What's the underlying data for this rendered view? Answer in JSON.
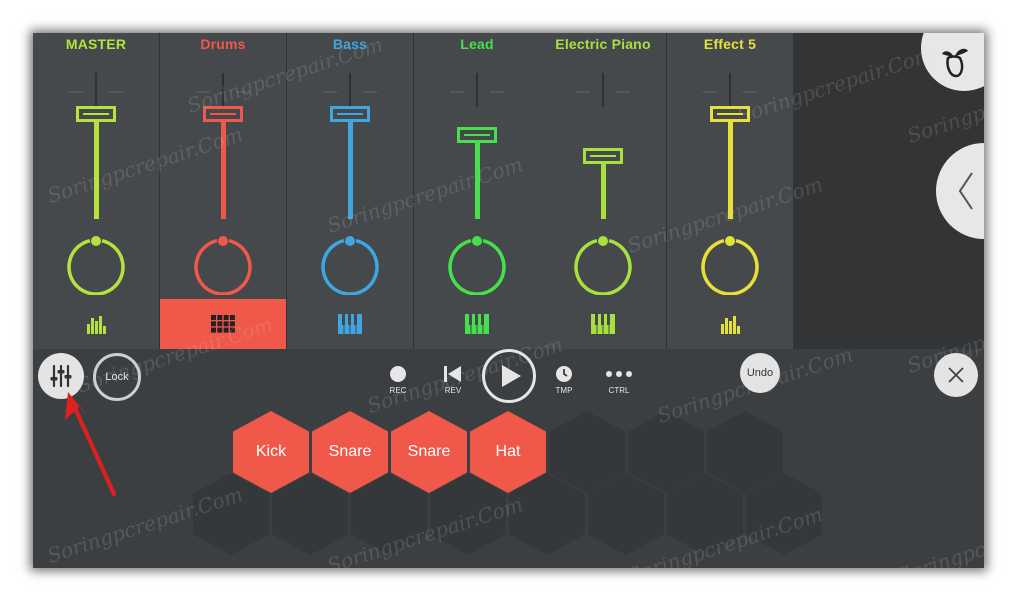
{
  "mixer": {
    "channels": [
      {
        "name": "MASTER",
        "color": "#b6e33b",
        "level": 0.7,
        "icon": "equalizer-bars-icon"
      },
      {
        "name": "Drums",
        "color": "#f0584a",
        "level": 0.7,
        "icon": "drum-pads-icon",
        "selected": true
      },
      {
        "name": "Bass",
        "color": "#3fa6e2",
        "level": 0.7,
        "icon": "piano-keys-icon"
      },
      {
        "name": "Lead",
        "color": "#45e04b",
        "level": 0.55,
        "icon": "piano-keys-icon"
      },
      {
        "name": "Electric Piano",
        "color": "#a8e03d",
        "level": 0.4,
        "icon": "piano-keys-icon"
      },
      {
        "name": "Effect 5",
        "color": "#e6e038",
        "level": 0.7,
        "icon": "equalizer-bars-icon"
      }
    ]
  },
  "toolbar": {
    "lock_label": "Lock",
    "undo_label": "Undo",
    "rec_label": "REC",
    "rev_label": "REV",
    "tmp_label": "TMP",
    "ctrl_label": "CTRL"
  },
  "pads": {
    "labels": [
      "Kick",
      "Snare",
      "Snare",
      "Hat"
    ]
  },
  "watermark": {
    "text": "Soringpcrepair.Com"
  },
  "colors": {
    "accent_red": "#f0584a",
    "background": "#3c3f41",
    "channel_bg": "#46494b",
    "annotation_arrow": "#e02020"
  }
}
